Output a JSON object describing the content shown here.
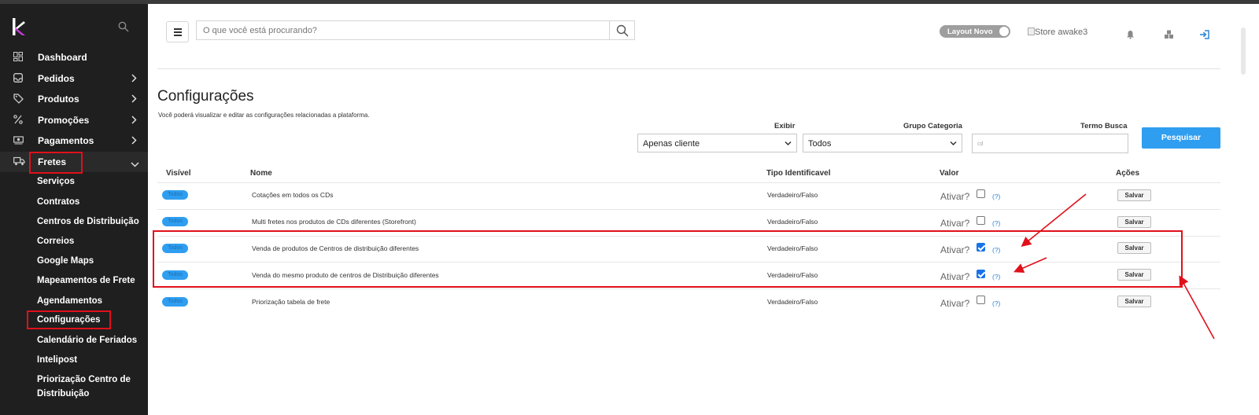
{
  "sidebar": {
    "nav": [
      {
        "label": "Dashboard",
        "icon": "dashboard-icon"
      },
      {
        "label": "Pedidos",
        "icon": "inbox-icon"
      },
      {
        "label": "Produtos",
        "icon": "tag-icon"
      },
      {
        "label": "Promoções",
        "icon": "percent-icon"
      },
      {
        "label": "Pagamentos",
        "icon": "money-icon"
      },
      {
        "label": "Fretes",
        "icon": "truck-icon"
      }
    ],
    "sub": [
      "Serviços",
      "Contratos",
      "Centros de Distribuição",
      "Correios",
      "Google Maps",
      "Mapeamentos de Frete",
      "Agendamentos",
      "Configurações",
      "Calendário de Feriados",
      "Intelipost",
      "Priorização Centro de",
      "Distribuição"
    ]
  },
  "header": {
    "search_placeholder": "O que você está procurando?",
    "layout_toggle": "Layout Novo",
    "store_alt": "Store awake3"
  },
  "page": {
    "title": "Configurações",
    "subtitle": "Você poderá visualizar e editar as configurações relacionadas a plataforma."
  },
  "filters": {
    "exibir_label": "Exibir",
    "exibir_value": "Apenas cliente",
    "grupo_label": "Grupo Categoria",
    "grupo_value": "Todos",
    "termo_label": "Termo Busca",
    "termo_placeholder": "cd",
    "search_button": "Pesquisar"
  },
  "table": {
    "headers": [
      "Visível",
      "Nome",
      "Tipo Identificavel",
      "Valor",
      "Ações"
    ],
    "ativar_label": "Ativar?",
    "help_label": "(?)",
    "save_label": "Salvar",
    "rows": [
      {
        "visible": "Todos",
        "name": "Cotações em todos os CDs",
        "type": "Verdadeiro/Falso",
        "checked": false
      },
      {
        "visible": "Todos",
        "name": "Multi fretes nos produtos de CDs diferentes (Storefront)",
        "type": "Verdadeiro/Falso",
        "checked": false
      },
      {
        "visible": "Todos",
        "name": "Venda de produtos de Centros de distribuição diferentes",
        "type": "Verdadeiro/Falso",
        "checked": true
      },
      {
        "visible": "Todos",
        "name": "Venda do mesmo produto de centros de Distribuição diferentes",
        "type": "Verdadeiro/Falso",
        "checked": true
      },
      {
        "visible": "Todos",
        "name": "Priorização tabela de frete",
        "type": "Verdadeiro/Falso",
        "checked": false
      }
    ]
  },
  "colors": {
    "sidebar_bg": "#1f1f1f",
    "accent": "#2f9ef0",
    "annotation_red": "#e0101b"
  }
}
